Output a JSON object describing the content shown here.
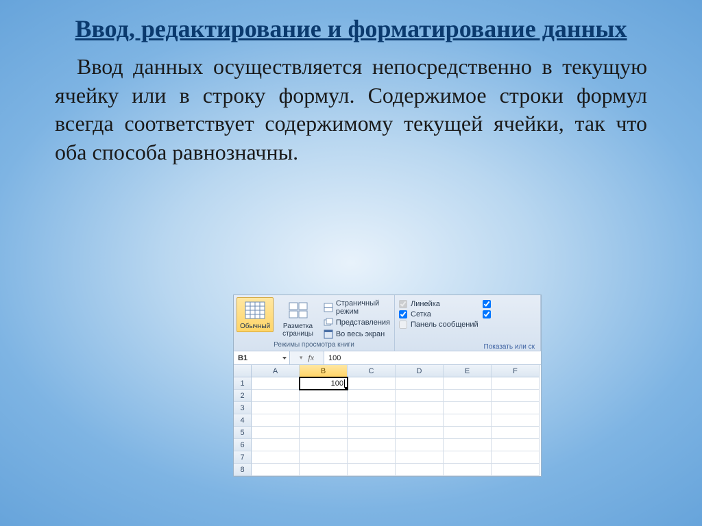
{
  "title": "Ввод, редактирование и форматирование данных",
  "body": "Ввод данных осуществляется непосредственно в текущую ячейку или в строку формул. Содержимое строки формул всегда соответствует содержимому текущей ячейки, так что оба способа равнозначны.",
  "excel": {
    "ribbon": {
      "group1_label": "Режимы просмотра книги",
      "btn_normal": "Обычный",
      "btn_page_layout": "Разметка страницы",
      "btn_page_break": "Страничный режим",
      "btn_custom_views": "Представления",
      "btn_fullscreen": "Во весь экран",
      "chk_ruler": "Линейка",
      "chk_grid": "Сетка",
      "chk_msgbar": "Панель сообщений",
      "group2_label": "Показать или ск"
    },
    "namebox": "B1",
    "formula_value": "100",
    "columns": [
      "A",
      "B",
      "C",
      "D",
      "E",
      "F"
    ],
    "rows": [
      "1",
      "2",
      "3",
      "4",
      "5",
      "6",
      "7",
      "8"
    ],
    "selected_cell_value": "100"
  }
}
